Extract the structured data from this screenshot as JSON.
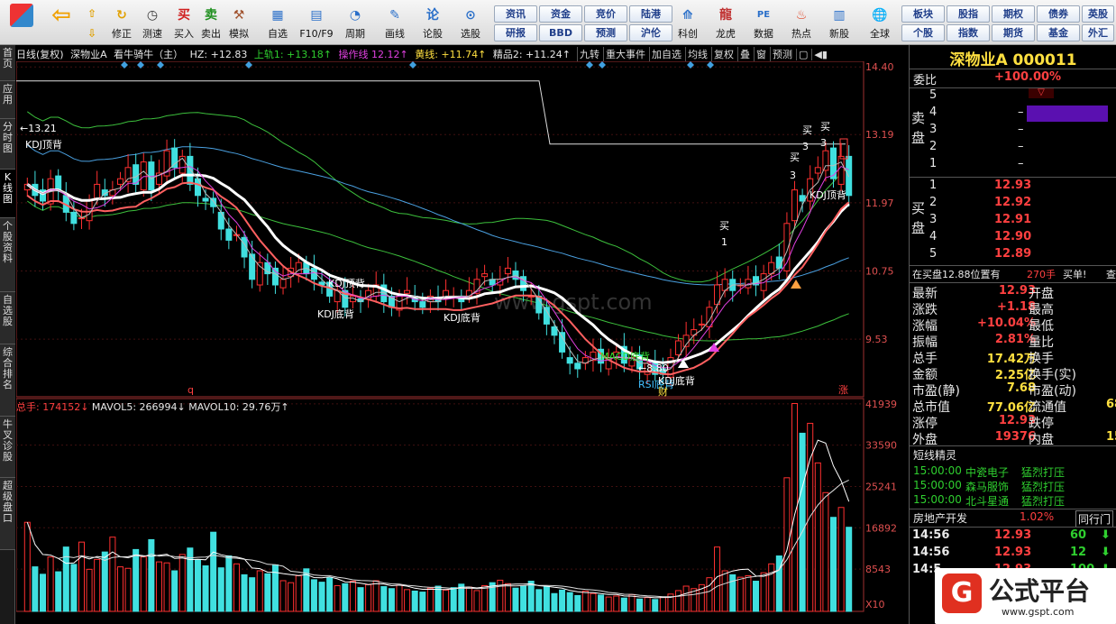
{
  "toolbar": {
    "nav": [
      {
        "label": "修正",
        "icon": "refresh-icon"
      },
      {
        "label": "测速",
        "icon": "clock-icon"
      }
    ],
    "trade": [
      {
        "label": "买入",
        "glyph": "买",
        "color": "#d02020"
      },
      {
        "label": "卖出",
        "glyph": "卖",
        "color": "#209020"
      },
      {
        "label": "模拟",
        "glyph": "锤",
        "color": "#a0522d"
      }
    ],
    "tools": [
      {
        "label": "自选"
      },
      {
        "label": "F10/F9"
      },
      {
        "label": "周期"
      },
      {
        "label": "画线"
      },
      {
        "label": "论股"
      },
      {
        "label": "选股"
      }
    ],
    "grid1": [
      [
        "资讯",
        "资金",
        "竞价",
        "陆港"
      ],
      [
        "研报",
        "BBD",
        "预测",
        "沪伦"
      ]
    ],
    "apps": [
      {
        "label": "科创"
      },
      {
        "label": "龙虎"
      },
      {
        "label": "数据"
      },
      {
        "label": "热点"
      },
      {
        "label": "新股"
      },
      {
        "label": "全球"
      }
    ],
    "grid2": [
      [
        "板块",
        "股指",
        "期权",
        "债券",
        "英股"
      ],
      [
        "个股",
        "指数",
        "期货",
        "基金",
        "外汇"
      ]
    ]
  },
  "sidetabs": [
    "首页",
    "应用",
    "分时图",
    "K线图",
    "个股资料",
    "自选股",
    "综合排名",
    "牛叉诊股",
    "超级盘口"
  ],
  "info": {
    "period": "日线(复权)",
    "name": "深物业A",
    "indicator": "看牛骑牛（主）",
    "hz": "HZ: +12.83",
    "upper": "上轨1: +13.18↑",
    "op": "操作线  12.12↑",
    "yellow": "黄线: +11.74↑",
    "fine": "精品2: +11.24↑"
  },
  "chart_buttons": [
    "九转",
    "重大事件",
    "加自选",
    "均线",
    "复权",
    "叠",
    "窗",
    "预测"
  ],
  "price_axis": [
    "14.40",
    "13.19",
    "11.97",
    "10.75",
    "9.53"
  ],
  "vol_axis": [
    "41939",
    "33590",
    "25241",
    "16892",
    "8543",
    "X10"
  ],
  "annotations": {
    "hi": "←13.21",
    "lo": "←8.80",
    "kdj1": "KDJ顶背",
    "kdj2": "KDJ顶背",
    "kdj3": "KDJ底背",
    "kdj4": "KDJ底背",
    "macd": "MACD底背",
    "rsi": "RSI底背",
    "kdj5": "KDJ底背",
    "kdj6": "KDJ顶背",
    "buy": "买",
    "n1": "1",
    "n3": "3",
    "q": "q",
    "zhang": "涨",
    "watermark": "www.gspt.com",
    "cai": "财"
  },
  "vol_header": {
    "total": "总手: 174152↓",
    "ma5": "MAVOL5: 266994↓",
    "ma10": "MAVOL10: 29.76万↑"
  },
  "quote": {
    "title": "深物业A 000011",
    "weibi_label": "委比",
    "weibi": "+100.00%",
    "sell_label": "卖盘",
    "buy_label": "买盘",
    "sell": [
      {
        "lv": "5",
        "p": "",
        "v": ""
      },
      {
        "lv": "4",
        "p": "",
        "v": "–"
      },
      {
        "lv": "3",
        "p": "",
        "v": "–"
      },
      {
        "lv": "2",
        "p": "",
        "v": "–"
      },
      {
        "lv": "1",
        "p": "",
        "v": "–"
      }
    ],
    "buy": [
      {
        "lv": "1",
        "p": "12.93"
      },
      {
        "lv": "2",
        "p": "12.92"
      },
      {
        "lv": "3",
        "p": "12.91"
      },
      {
        "lv": "4",
        "p": "12.90"
      },
      {
        "lv": "5",
        "p": "12.89"
      }
    ],
    "bid_line": "在买盘12.88位置有",
    "bid_vol": "270手",
    "bid_act": "买单!",
    "bid_more": "查",
    "stats": [
      [
        "最新",
        "12.93",
        "开盘",
        ""
      ],
      [
        "涨跌",
        "+1.18",
        "最高",
        ""
      ],
      [
        "涨幅",
        "+10.04%",
        "最低",
        ""
      ],
      [
        "振幅",
        "2.81%",
        "量比",
        ""
      ],
      [
        "总手",
        "17.42万",
        "换手",
        ""
      ],
      [
        "金额",
        "2.25亿",
        "换手(实)",
        ""
      ],
      [
        "市盈(静)",
        "7.68",
        "市盈(动)",
        ""
      ],
      [
        "总市值",
        "77.06亿",
        "流通值",
        "68"
      ],
      [
        "涨停",
        "12.93",
        "跌停",
        ""
      ],
      [
        "外盘",
        "19376",
        "内盘",
        "15"
      ]
    ],
    "sprite_title": "短线精灵",
    "sprites": [
      [
        "15:00:00",
        "中瓷电子",
        "猛烈打压"
      ],
      [
        "15:00:00",
        "森马服饰",
        "猛烈打压"
      ],
      [
        "15:00:00",
        "北斗星通",
        "猛烈打压"
      ]
    ],
    "sector": "房地产开发",
    "sector_pct": "1.02%",
    "sector_btn": "同行门",
    "ticks": [
      [
        "14:56",
        "12.93",
        "60"
      ],
      [
        "14:56",
        "12.93",
        "12"
      ],
      [
        "14:5",
        "12.93",
        "100"
      ]
    ]
  },
  "logo": {
    "text": "公式平台",
    "url": "www.gspt.com"
  },
  "chart_data": {
    "type": "candlestick",
    "ylim": [
      8.5,
      14.5
    ],
    "price_ticks": [
      14.4,
      13.19,
      11.97,
      10.75,
      9.53
    ],
    "vol_ticks": [
      41939,
      33590,
      25241,
      16892,
      8543
    ],
    "vol_max": 43000,
    "closes": [
      12.3,
      12.1,
      12.0,
      12.4,
      12.2,
      11.8,
      11.6,
      11.7,
      12.0,
      12.3,
      12.1,
      12.2,
      12.4,
      12.6,
      12.3,
      12.7,
      12.2,
      12.5,
      12.9,
      12.6,
      12.8,
      12.3,
      12.1,
      12.0,
      11.9,
      11.5,
      11.3,
      11.4,
      11.0,
      10.6,
      10.9,
      10.7,
      10.5,
      10.6,
      10.8,
      10.9,
      10.7,
      10.6,
      10.5,
      10.3,
      10.4,
      10.1,
      10.3,
      10.2,
      10.4,
      10.5,
      10.2,
      10.1,
      10.3,
      10.4,
      10.2,
      10.1,
      10.3,
      10.2,
      10.4,
      10.3,
      10.2,
      10.4,
      10.6,
      10.7,
      10.5,
      10.6,
      10.8,
      10.6,
      10.4,
      10.3,
      10.0,
      9.8,
      9.6,
      9.3,
      9.1,
      9.0,
      9.2,
      9.3,
      9.1,
      9.2,
      9.3,
      9.1,
      9.2,
      9.0,
      9.1,
      8.9,
      8.9,
      9.2,
      9.5,
      9.6,
      9.7,
      9.8,
      10.1,
      10.5,
      10.6,
      10.4,
      10.5,
      10.6,
      10.5,
      10.7,
      10.9,
      10.8,
      11.6,
      12.2,
      12.0,
      12.4,
      12.6,
      12.9,
      12.4,
      12.8,
      12.1
    ],
    "volumes": [
      18000,
      9000,
      7500,
      11000,
      8000,
      13000,
      9500,
      14000,
      8500,
      10500,
      12000,
      15000,
      9000,
      8700,
      12500,
      11000,
      14500,
      10000,
      9800,
      8200,
      11500,
      12800,
      10400,
      9200,
      16000,
      8800,
      11200,
      9600,
      7400,
      6800,
      8200,
      7600,
      9400,
      6200,
      5800,
      7200,
      8600,
      6400,
      5900,
      6800,
      5200,
      5600,
      6100,
      4800,
      5400,
      6200,
      5000,
      4600,
      5300,
      4400,
      4100,
      3900,
      4700,
      5100,
      4300,
      4800,
      5500,
      4900,
      4200,
      5200,
      5800,
      6300,
      5600,
      4700,
      5200,
      6100,
      4400,
      5000,
      3600,
      4300,
      3800,
      3200,
      4100,
      3600,
      3300,
      2900,
      3100,
      2700,
      3400,
      2500,
      2800,
      2400,
      2900,
      3500,
      4200,
      5100,
      4600,
      5400,
      6800,
      13000,
      8200,
      7400,
      6900,
      7200,
      6100,
      7800,
      9600,
      11200,
      27000,
      42000,
      36000,
      38000,
      30000,
      24000,
      19000,
      21000,
      17000
    ]
  }
}
